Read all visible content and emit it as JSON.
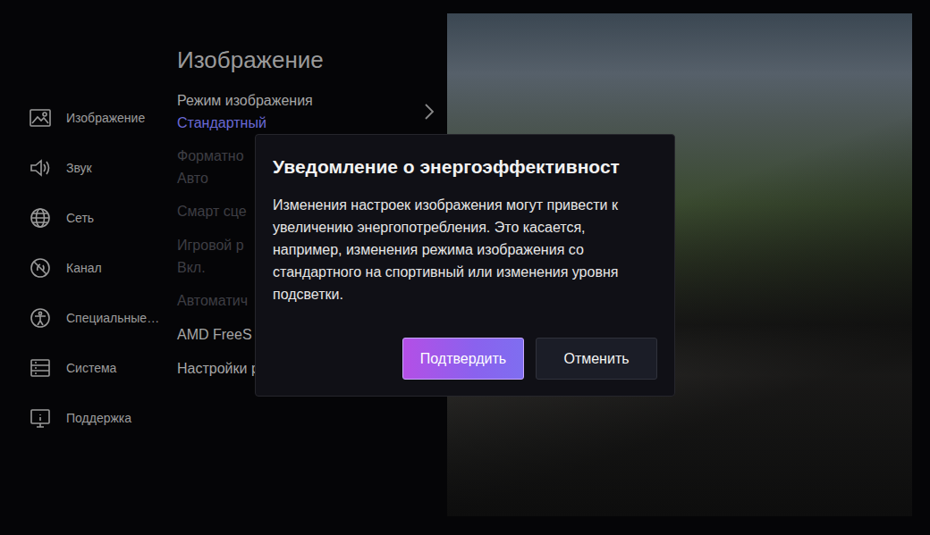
{
  "sidebar": {
    "items": [
      {
        "label": "Изображение"
      },
      {
        "label": "Звук"
      },
      {
        "label": "Сеть"
      },
      {
        "label": "Канал"
      },
      {
        "label": "Специальные…"
      },
      {
        "label": "Система"
      },
      {
        "label": "Поддержка"
      }
    ]
  },
  "panel": {
    "title": "Изображение",
    "items": [
      {
        "label": "Режим изображения",
        "value": "Стандартный",
        "disabled": false,
        "submenu": true
      },
      {
        "label": "Форматно",
        "value": "Авто",
        "disabled": true,
        "submenu": false
      },
      {
        "label": "Смарт сце",
        "value": "",
        "disabled": true,
        "submenu": false
      },
      {
        "label": "Игровой р",
        "value": "Вкл.",
        "disabled": true,
        "submenu": false
      },
      {
        "label": "Автоматич",
        "value": "",
        "disabled": true,
        "submenu": false
      },
      {
        "label": "AMD FreeS",
        "value": "",
        "disabled": false,
        "submenu": false
      },
      {
        "label": "Настройки режима изображ…",
        "value": "",
        "disabled": false,
        "submenu": true
      }
    ]
  },
  "dialog": {
    "title": "Уведомление о энергоэффективност",
    "message": "Изменения настроек изображения могут привести к увеличению энергопотребления. Это касается, например, изменения режима изображения со стандартного на спортивный или изменения уровня подсветки.",
    "buttons": [
      {
        "label": "Подтвердить",
        "selected": true
      },
      {
        "label": "Отменить",
        "selected": false
      }
    ]
  }
}
